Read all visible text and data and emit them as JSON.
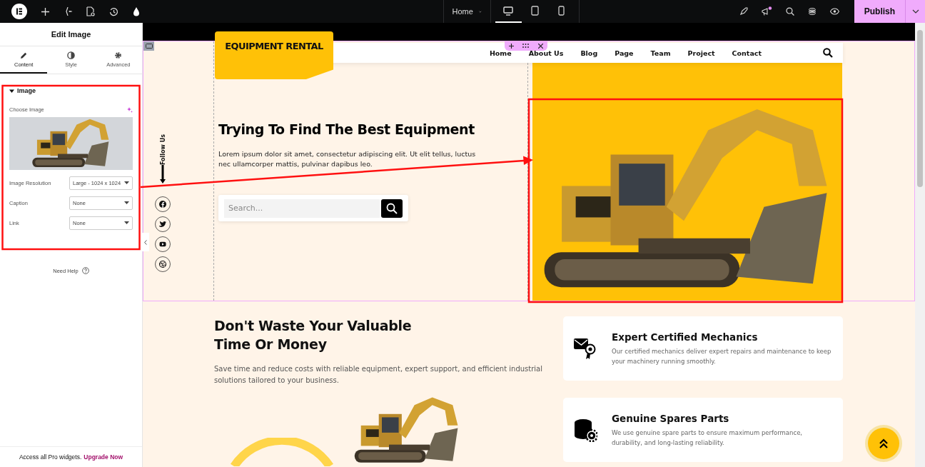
{
  "top_bar": {
    "page_selector": "Home",
    "devices": [
      {
        "kind": "desktop",
        "selected": true
      },
      {
        "kind": "tablet",
        "selected": false
      },
      {
        "kind": "mobile",
        "selected": false
      }
    ],
    "publish": "Publish"
  },
  "panel": {
    "title": "Edit Image",
    "tabs": [
      {
        "label": "Content",
        "kind": "pencil",
        "selected": true
      },
      {
        "label": "Style",
        "kind": "contrast",
        "selected": false
      },
      {
        "label": "Advanced",
        "kind": "gear",
        "selected": false
      }
    ],
    "section": {
      "title": "Image",
      "expanded": true,
      "choose_label": "Choose Image",
      "fields": [
        {
          "label": "Image Resolution",
          "value": "Large - 1024 x 1024"
        },
        {
          "label": "Caption",
          "value": "None"
        },
        {
          "label": "Link",
          "value": "None"
        }
      ]
    },
    "help": "Need Help",
    "promo": {
      "text": "Access all Pro widgets.",
      "link": "Upgrade Now"
    }
  },
  "site": {
    "logo": "EQUIPMENT RENTAL",
    "nav": [
      "Home",
      "About Us",
      "Blog",
      "Page",
      "Team",
      "Project",
      "Contact"
    ],
    "follow": "Follow Us",
    "socials": [
      {
        "kind": "facebook"
      },
      {
        "kind": "twitter"
      },
      {
        "kind": "youtube"
      },
      {
        "kind": "dribbble"
      }
    ],
    "hero": {
      "heading": "Trying To Find The Best Equipment",
      "text": "Lorem ipsum dolor sit amet, consectetur adipiscing elit. Ut elit tellus, luctus nec ullamcorper mattis, pulvinar dapibus leo.",
      "search_placeholder": "Search..."
    },
    "section2": {
      "heading_lines": [
        "Don't Waste Your Valuable",
        "Time Or Money"
      ],
      "text": "Save time and reduce costs with reliable equipment, expert support, and efficient industrial solutions tailored to your business.",
      "features": [
        {
          "kind": "certificate",
          "title": "Expert Certified Mechanics",
          "text": "Our certified mechanics deliver expert repairs and maintenance to keep your machinery running smoothly."
        },
        {
          "kind": "parts",
          "title": "Genuine Spares Parts",
          "text": "We use genuine spare parts to ensure maximum performance, durability, and long-lasting reliability."
        }
      ]
    }
  }
}
